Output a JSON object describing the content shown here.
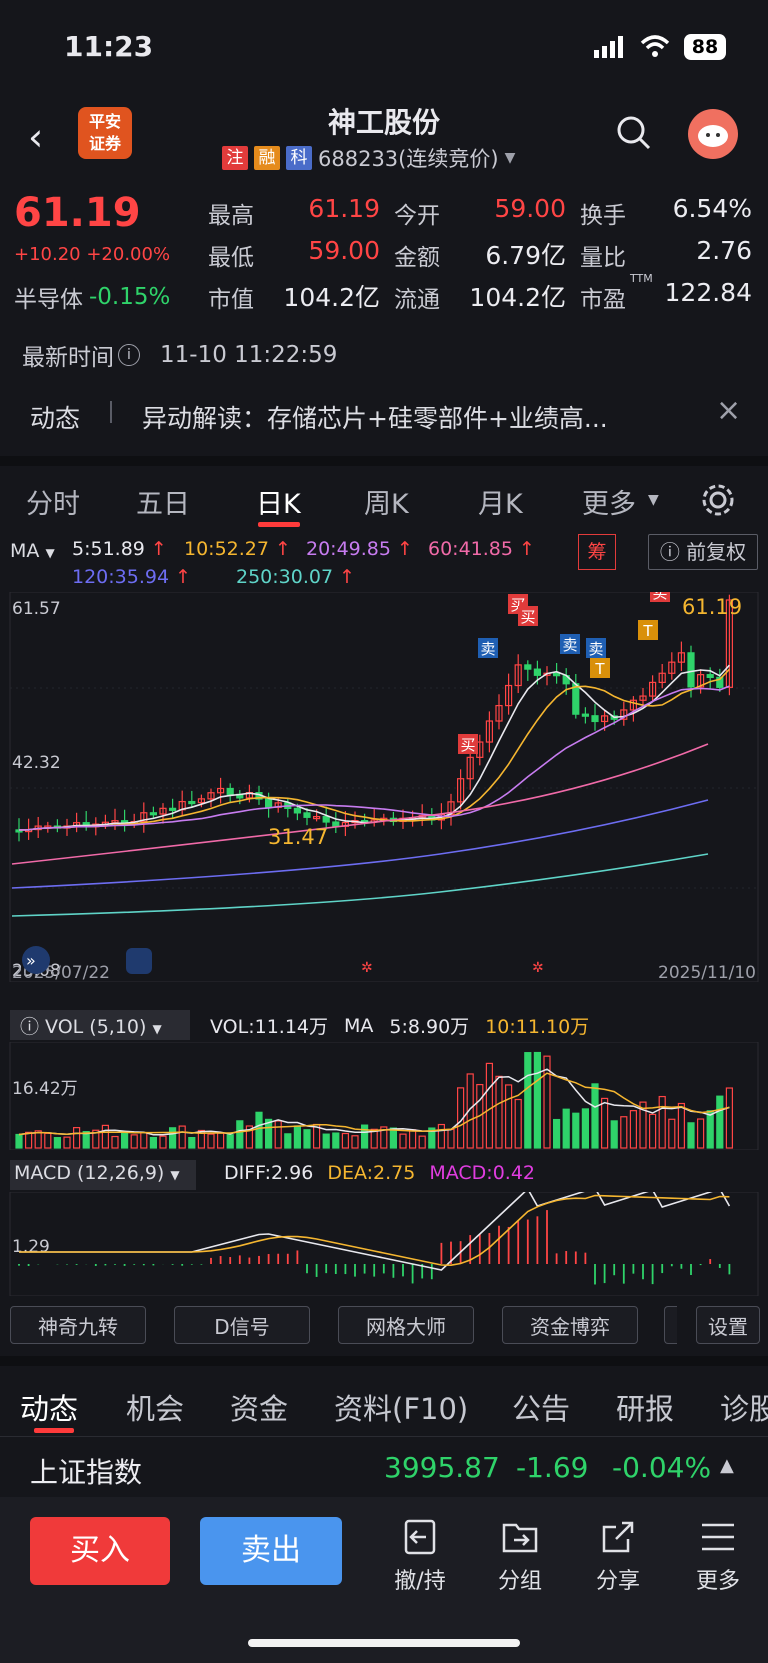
{
  "status_bar": {
    "time": "11:23",
    "battery": "88"
  },
  "header": {
    "logo_line1": "平安",
    "logo_line2": "证券",
    "stock_name": "神工股份",
    "tags": [
      "注",
      "融",
      "科"
    ],
    "tag_colors": [
      "#e23b3b",
      "#e58b1c",
      "#4a6cc9"
    ],
    "code_info": "688233(连续竞价)"
  },
  "quote": {
    "price": "61.19",
    "change": "+10.20 +20.00%",
    "sector_name": "半导体",
    "sector_change": "-0.15%",
    "high_label": "最高",
    "high": "61.19",
    "low_label": "最低",
    "low": "59.00",
    "mktcap_label": "市值",
    "mktcap": "104.2亿",
    "open_label": "今开",
    "open": "59.00",
    "amount_label": "金额",
    "amount": "6.79亿",
    "float_label": "流通",
    "float": "104.2亿",
    "turnover_label": "换手",
    "turnover": "6.54%",
    "volratio_label": "量比",
    "volratio": "2.76",
    "pe_label": "市盈",
    "pe_sup": "TTM",
    "pe": "122.84",
    "time_label": "最新时间",
    "time_value": "11-10 11:22:59"
  },
  "news": {
    "label": "动态",
    "text": "异动解读：存储芯片+硅零部件+业绩高..."
  },
  "chart_tabs": [
    "分时",
    "五日",
    "日K",
    "周K",
    "月K",
    "更多"
  ],
  "active_chart_tab": "日K",
  "ma_line": {
    "label": "MA",
    "items": [
      {
        "text": "5:51.89",
        "color": "#e8e8ee"
      },
      {
        "text": "10:52.27",
        "color": "#f5b630"
      },
      {
        "text": "20:49.85",
        "color": "#c77cf0"
      },
      {
        "text": "60:41.85",
        "color": "#f06aa8"
      },
      {
        "text": "120:35.94",
        "color": "#6d6df2"
      },
      {
        "text": "250:30.07",
        "color": "#5fd4c8"
      }
    ],
    "chip_label": "筹",
    "fq_label": "前复权"
  },
  "chart_data": [
    {
      "type": "candlestick",
      "y_tick_labels": [
        "61.57",
        "42.32",
        "23.08"
      ],
      "x_tick_labels": [
        "2025/07/22",
        "2025/11/10"
      ],
      "annotations": [
        "31.47",
        "61.19"
      ],
      "signals": [
        "买",
        "买",
        "买",
        "卖",
        "卖",
        "卖",
        "买",
        "卖",
        "T",
        "T"
      ]
    },
    {
      "type": "bar",
      "title": "VOL (5,10)",
      "values_text": [
        "VOL:11.14万",
        "MA",
        "5:8.90万",
        "10:11.10万"
      ],
      "y_tick_labels": [
        "16.42万"
      ]
    },
    {
      "type": "line",
      "title": "MACD (12,26,9)",
      "values_text": [
        "DIFF:2.96",
        "DEA:2.75",
        "MACD:0.42"
      ],
      "y_tick_labels": [
        "1.29"
      ]
    }
  ],
  "indicator_buttons": [
    "神奇九转",
    "D信号",
    "网格大师",
    "资金博弈",
    "设置"
  ],
  "sub_tabs": [
    "动态",
    "机会",
    "资金",
    "资料(F10)",
    "公告",
    "研报",
    "诊股"
  ],
  "index_bar": {
    "name": "上证指数",
    "value": "3995.87",
    "change": "-1.69",
    "pct": "-0.04%"
  },
  "actions": {
    "buy": "买入",
    "sell": "卖出",
    "cancel": "撤/持",
    "group": "分组",
    "share": "分享",
    "more": "更多"
  }
}
